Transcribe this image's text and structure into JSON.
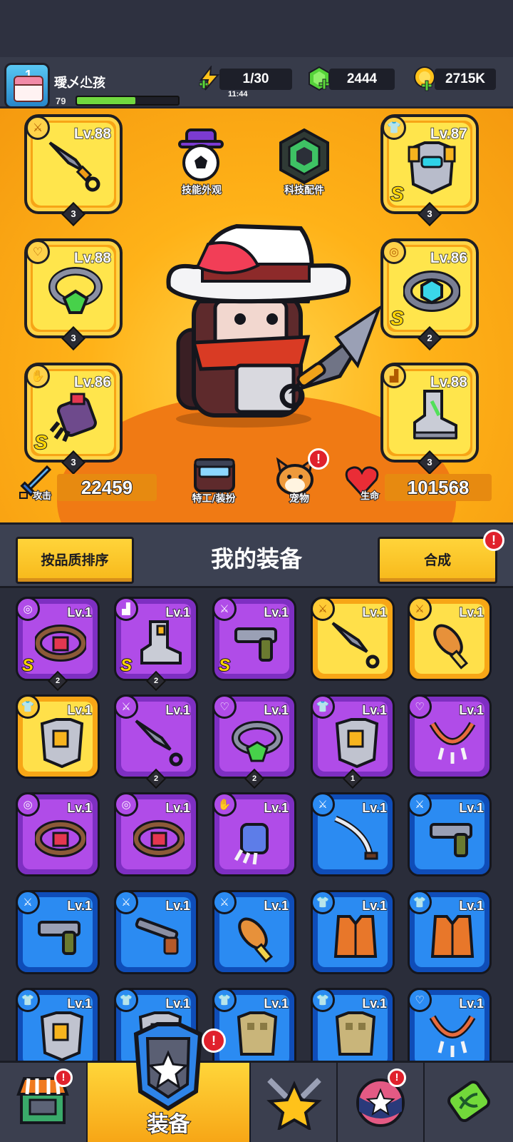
{
  "player": {
    "name": "璦乄尐孩",
    "avatar_number": "1",
    "level": "79",
    "xp_fraction": 0.58
  },
  "resources": {
    "energy": "1/30",
    "energy_timer": "11:44",
    "gems": "2444",
    "coins": "2715K"
  },
  "hero_panel": {
    "left_slots": [
      {
        "level": "Lv.88",
        "stars": "3",
        "grade": "",
        "item": "kunai"
      },
      {
        "level": "Lv.88",
        "stars": "3",
        "grade": "",
        "item": "ring"
      },
      {
        "level": "Lv.86",
        "stars": "3",
        "grade": "S",
        "item": "gauntlet"
      }
    ],
    "right_slots": [
      {
        "level": "Lv.87",
        "stars": "3",
        "grade": "S",
        "item": "armor"
      },
      {
        "level": "Lv.86",
        "stars": "2",
        "grade": "S",
        "item": "belt"
      },
      {
        "level": "Lv.88",
        "stars": "3",
        "grade": "",
        "item": "boots"
      }
    ],
    "skill_skin_label": "技能外观",
    "tech_parts_label": "科技配件",
    "agent_outfit_label": "特工/装扮",
    "pet_label": "宠物",
    "attack_label": "攻击",
    "attack_value": "22459",
    "hp_label": "生命",
    "hp_value": "101568"
  },
  "equip_header": {
    "sort_button": "按品质排序",
    "title": "我的装备",
    "merge_button": "合成"
  },
  "inventory": [
    {
      "rarity": "purple",
      "level": "Lv.1",
      "grade": "S",
      "stars": "2",
      "item": "belt",
      "cat": "belt"
    },
    {
      "rarity": "purple",
      "level": "Lv.1",
      "grade": "S",
      "stars": "2",
      "item": "boots",
      "cat": "boots"
    },
    {
      "rarity": "purple",
      "level": "Lv.1",
      "grade": "S",
      "stars": "",
      "item": "gun",
      "cat": "weapon"
    },
    {
      "rarity": "gold",
      "level": "Lv.1",
      "grade": "",
      "stars": "",
      "item": "kunai",
      "cat": "weapon"
    },
    {
      "rarity": "gold",
      "level": "Lv.1",
      "grade": "",
      "stars": "",
      "item": "club",
      "cat": "weapon"
    },
    {
      "rarity": "gold",
      "level": "Lv.1",
      "grade": "",
      "stars": "",
      "item": "armor",
      "cat": "armor"
    },
    {
      "rarity": "purple",
      "level": "Lv.1",
      "grade": "",
      "stars": "2",
      "item": "kunai",
      "cat": "weapon"
    },
    {
      "rarity": "purple",
      "level": "Lv.1",
      "grade": "",
      "stars": "2",
      "item": "ring",
      "cat": "ring"
    },
    {
      "rarity": "purple",
      "level": "Lv.1",
      "grade": "",
      "stars": "1",
      "item": "armor",
      "cat": "armor"
    },
    {
      "rarity": "purple",
      "level": "Lv.1",
      "grade": "",
      "stars": "",
      "item": "necklace",
      "cat": "ring"
    },
    {
      "rarity": "purple",
      "level": "Lv.1",
      "grade": "",
      "stars": "",
      "item": "belt",
      "cat": "belt"
    },
    {
      "rarity": "purple",
      "level": "Lv.1",
      "grade": "",
      "stars": "",
      "item": "belt",
      "cat": "belt"
    },
    {
      "rarity": "purple",
      "level": "Lv.1",
      "grade": "",
      "stars": "",
      "item": "gauntlet",
      "cat": "glove"
    },
    {
      "rarity": "blue",
      "level": "Lv.1",
      "grade": "",
      "stars": "",
      "item": "sword",
      "cat": "weapon"
    },
    {
      "rarity": "blue",
      "level": "Lv.1",
      "grade": "",
      "stars": "",
      "item": "gun",
      "cat": "weapon"
    },
    {
      "rarity": "blue",
      "level": "Lv.1",
      "grade": "",
      "stars": "",
      "item": "gun",
      "cat": "weapon"
    },
    {
      "rarity": "blue",
      "level": "Lv.1",
      "grade": "",
      "stars": "",
      "item": "shotgun",
      "cat": "weapon"
    },
    {
      "rarity": "blue",
      "level": "Lv.1",
      "grade": "",
      "stars": "",
      "item": "club",
      "cat": "weapon"
    },
    {
      "rarity": "blue",
      "level": "Lv.1",
      "grade": "",
      "stars": "",
      "item": "vest",
      "cat": "armor"
    },
    {
      "rarity": "blue",
      "level": "Lv.1",
      "grade": "",
      "stars": "",
      "item": "vest",
      "cat": "armor"
    },
    {
      "rarity": "blue",
      "level": "Lv.1",
      "grade": "",
      "stars": "",
      "item": "armor",
      "cat": "armor"
    },
    {
      "rarity": "blue",
      "level": "Lv.1",
      "grade": "",
      "stars": "",
      "item": "armor",
      "cat": "armor"
    },
    {
      "rarity": "blue",
      "level": "Lv.1",
      "grade": "",
      "stars": "",
      "item": "shirt",
      "cat": "armor"
    },
    {
      "rarity": "blue",
      "level": "Lv.1",
      "grade": "",
      "stars": "",
      "item": "shirt",
      "cat": "armor"
    },
    {
      "rarity": "blue",
      "level": "Lv.1",
      "grade": "",
      "stars": "",
      "item": "necklace",
      "cat": "ring"
    }
  ],
  "nav": {
    "tabs": [
      "shop",
      "equipment",
      "battle",
      "events",
      "lab"
    ],
    "active_label": "装备"
  },
  "badges": {
    "exclamation": "!"
  }
}
